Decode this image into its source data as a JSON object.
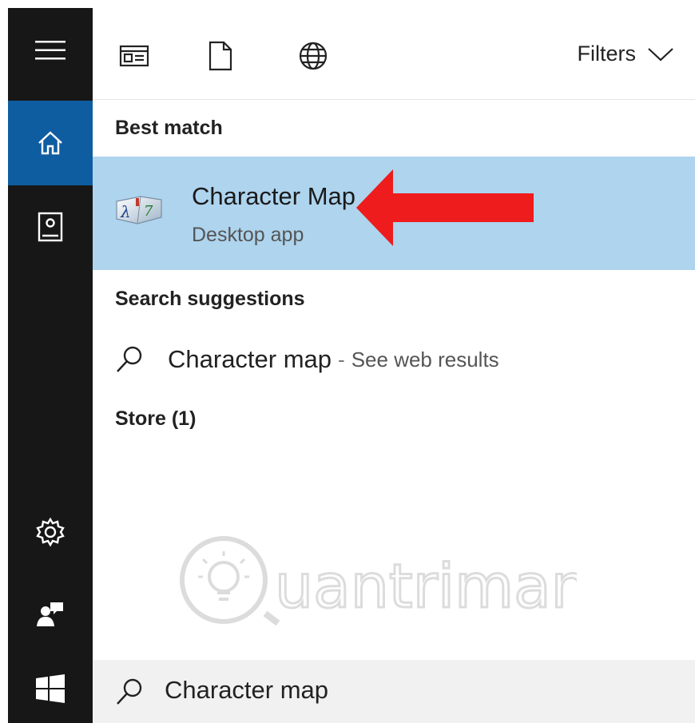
{
  "toolbar": {
    "filters_label": "Filters",
    "icons": [
      "apps-icon",
      "documents-icon",
      "web-icon"
    ]
  },
  "rail": {
    "icons": [
      "hamburger-menu-icon",
      "home-icon",
      "notebook-icon",
      "settings-icon",
      "feedback-icon",
      "windows-start-icon"
    ]
  },
  "results": {
    "best_match_heading": "Best match",
    "best_match": {
      "name": "Character Map",
      "type": "Desktop app",
      "icon": "character-map-app-icon"
    },
    "suggestions_heading": "Search suggestions",
    "suggestion": {
      "query": "Character map",
      "separator": "-",
      "hint": "See web results"
    },
    "store_heading": "Store (1)"
  },
  "annotation": {
    "arrow_color": "#ee1c1c"
  },
  "search": {
    "query": "Character map"
  },
  "colors": {
    "rail_bg": "#171717",
    "rail_active": "#0f5da1",
    "selected_bg": "#aed4ee"
  }
}
